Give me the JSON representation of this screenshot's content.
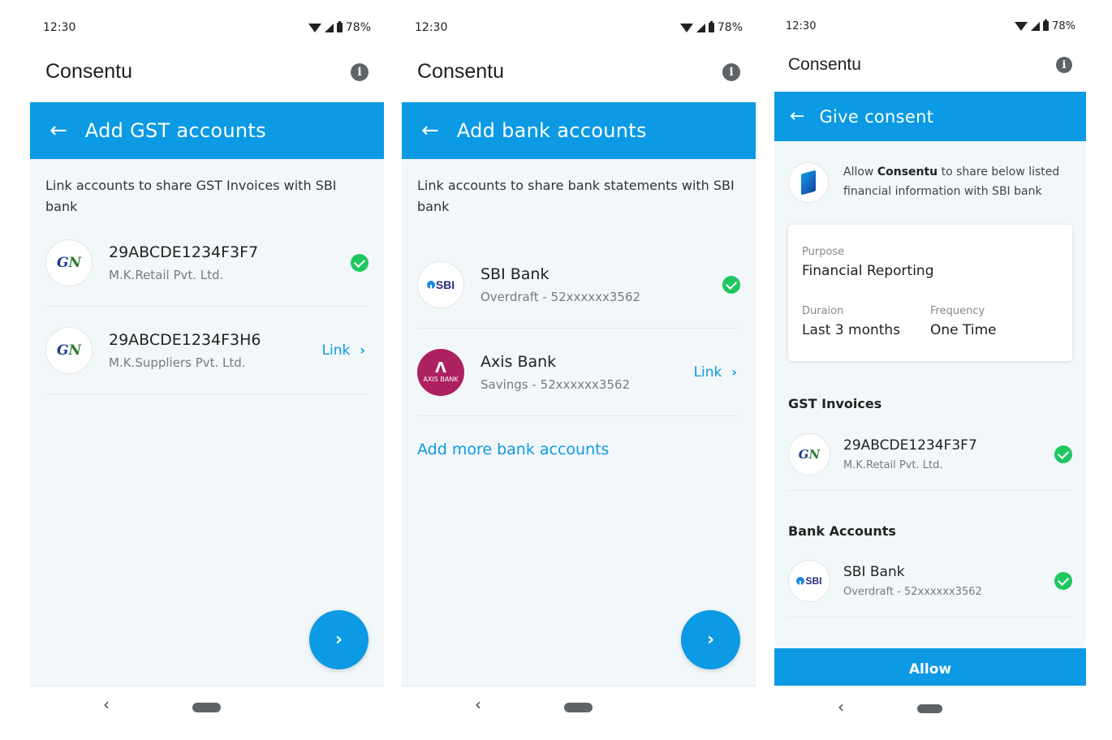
{
  "status": {
    "time": "12:30",
    "battery": "78%"
  },
  "app": {
    "title": "Consentu"
  },
  "screen1": {
    "header": "Add GST accounts",
    "intro": "Link accounts to share GST Invoices with SBI bank",
    "accounts": [
      {
        "title": "29ABCDE1234F3F7",
        "subtitle": "M.K.Retail Pvt. Ltd.",
        "state": "linked"
      },
      {
        "title": "29ABCDE1234F3H6",
        "subtitle": "M.K.Suppliers Pvt. Ltd.",
        "state": "link",
        "link_label": "Link"
      }
    ]
  },
  "screen2": {
    "header": "Add bank accounts",
    "intro": "Link accounts to share bank statements with SBI bank",
    "accounts": [
      {
        "title": "SBI Bank",
        "subtitle": "Overdraft - 52xxxxxx3562",
        "state": "linked"
      },
      {
        "title": "Axis Bank",
        "subtitle": "Savings - 52xxxxxx3562",
        "state": "link",
        "link_label": "Link"
      }
    ],
    "add_more": "Add more bank accounts",
    "axis_logo_text": "AXIS BANK",
    "sbi_logo_text": "SBI"
  },
  "screen3": {
    "header": "Give consent",
    "consent_prefix": "Allow ",
    "consent_brand": "Consentu",
    "consent_suffix": " to share below listed financial information with SBI bank",
    "purpose_label": "Purpose",
    "purpose_value": "Financial Reporting",
    "duration_label": "Duraion",
    "duration_value": "Last 3 months",
    "frequency_label": "Frequency",
    "frequency_value": "One Time",
    "gst_section": "GST Invoices",
    "gst_item": {
      "title": "29ABCDE1234F3F7",
      "subtitle": "M.K.Retail Pvt. Ltd."
    },
    "bank_section": "Bank Accounts",
    "bank_item": {
      "title": "SBI Bank",
      "subtitle": "Overdraft - 52xxxxxx3562"
    },
    "allow_label": "Allow"
  },
  "colors": {
    "primary": "#0b9ae3",
    "success": "#1ec760",
    "axis": "#ae2160",
    "background": "#f2f7fa"
  },
  "icons": [
    "wifi-icon",
    "signal-icon",
    "battery-icon",
    "info-icon",
    "back-arrow-icon",
    "check-icon",
    "chevron-right-icon",
    "nav-back-icon",
    "nav-home-icon"
  ]
}
